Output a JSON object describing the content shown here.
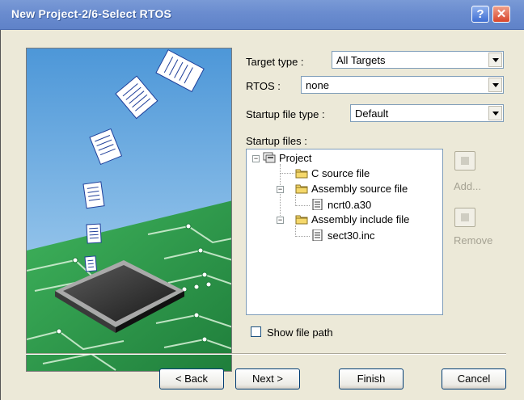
{
  "window": {
    "title": "New Project-2/6-Select RTOS",
    "help_label": "?",
    "close_label": "✕"
  },
  "form": {
    "target_type": {
      "label": "Target type :",
      "value": "All Targets"
    },
    "rtos": {
      "label": "RTOS :",
      "value": "none"
    },
    "startup_file_type": {
      "label": "Startup file type :",
      "value": "Default"
    },
    "startup_files_label": "Startup files :"
  },
  "tree": {
    "root": "Project",
    "items": [
      {
        "label": "C source file",
        "icon": "folder-icon"
      },
      {
        "label": "Assembly source file",
        "icon": "folder-icon"
      },
      {
        "label": "ncrt0.a30",
        "icon": "file-icon"
      },
      {
        "label": "Assembly include file",
        "icon": "folder-icon"
      },
      {
        "label": "sect30.inc",
        "icon": "file-icon"
      }
    ]
  },
  "side_buttons": {
    "add_label": "Add...",
    "remove_label": "Remove"
  },
  "show_file_path": {
    "label": "Show file path",
    "checked": false
  },
  "buttons": {
    "back": "< Back",
    "next": "Next >",
    "finish": "Finish",
    "cancel": "Cancel"
  },
  "colors": {
    "titlebar": "#6a8ccf",
    "dialog_bg": "#ece9d8",
    "pcb_green": "#2c9a48",
    "sky_blue": "#74b2e2"
  }
}
